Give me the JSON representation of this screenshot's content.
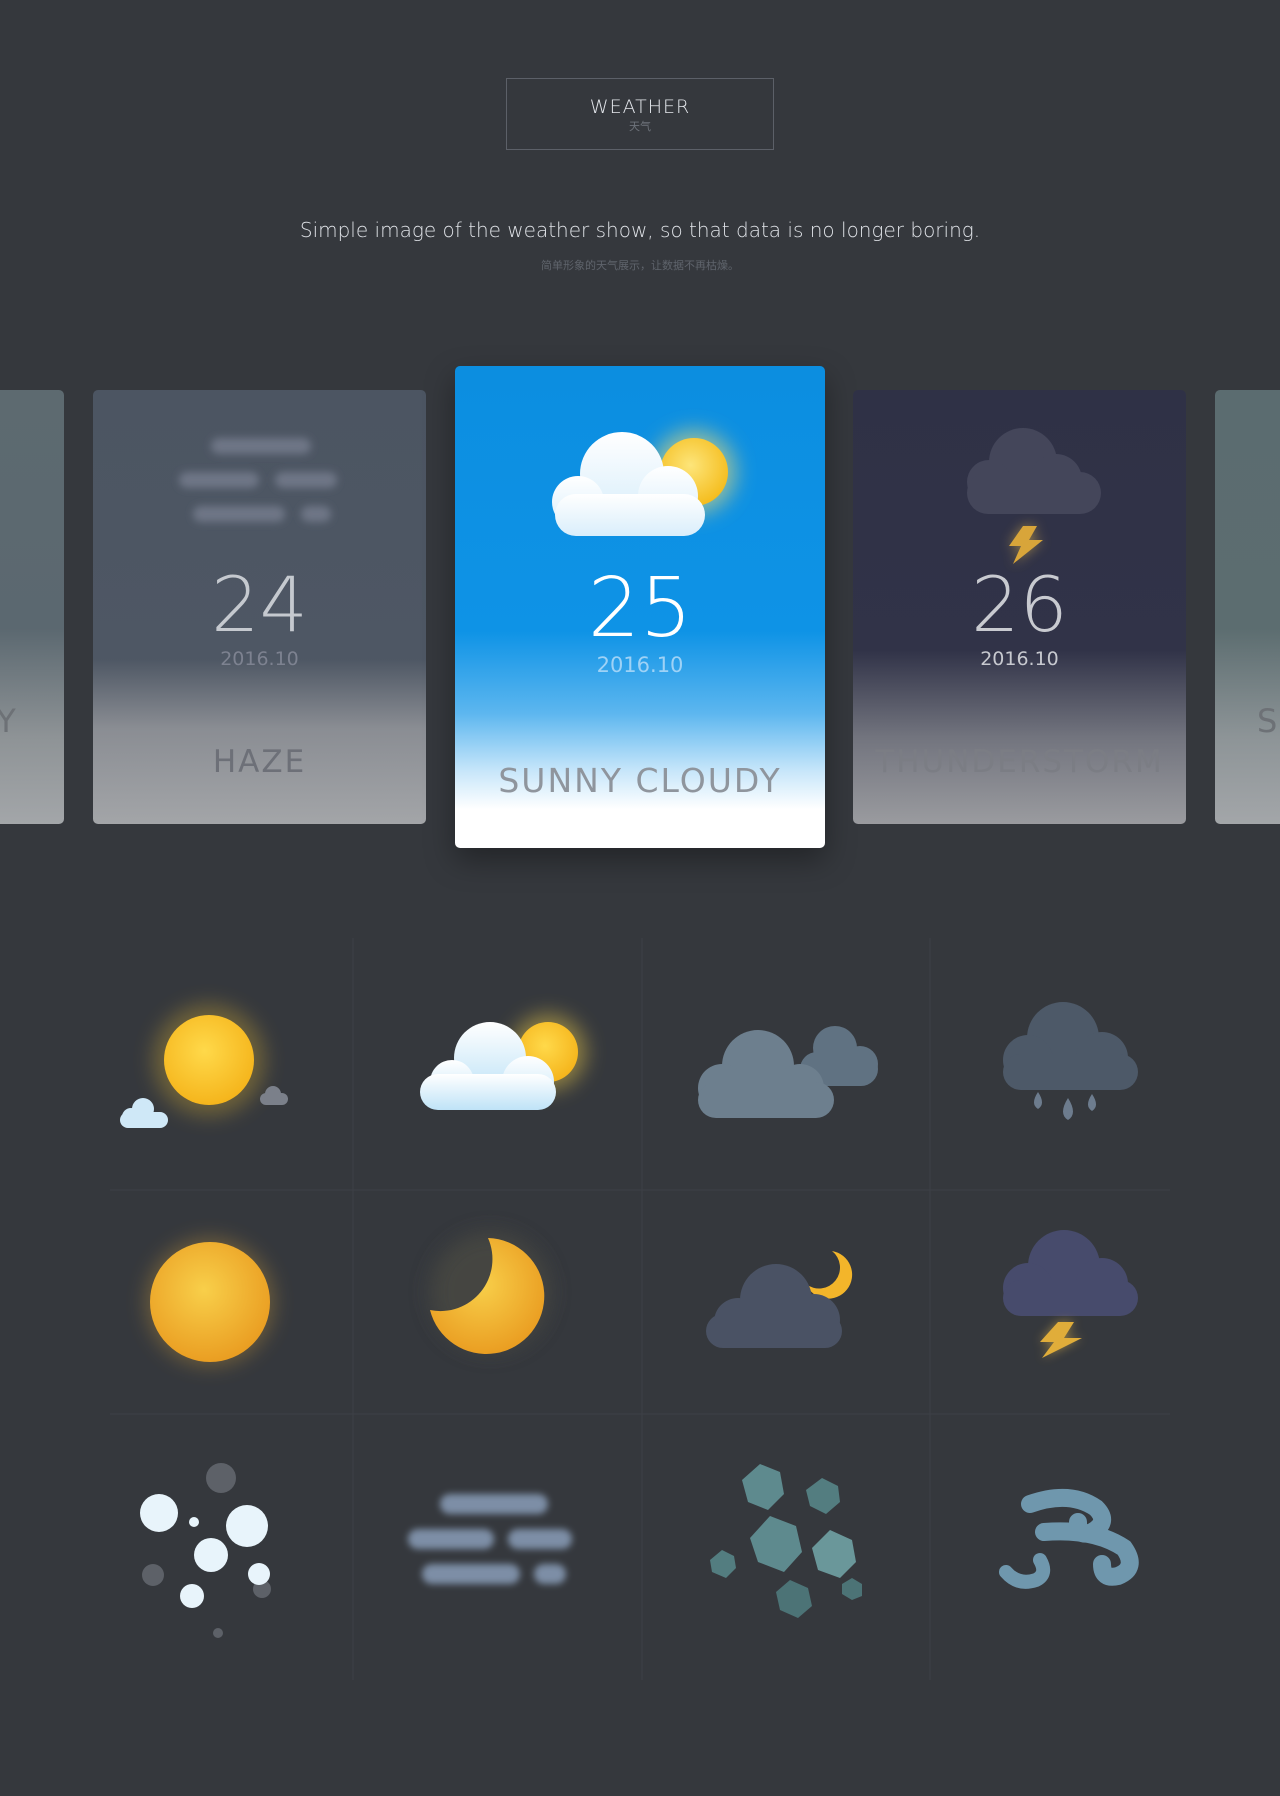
{
  "header": {
    "title": "WEATHER",
    "subtitle": "天气"
  },
  "tagline": {
    "main": "Simple image of the weather show, so that data is no longer boring.",
    "sub": "简单形象的天气展示，让数据不再枯燥。"
  },
  "cards": {
    "left_edge": {
      "condition": "Y"
    },
    "haze": {
      "temperature": "24",
      "date": "2016.10",
      "condition": "HAZE",
      "icon": "haze-icon"
    },
    "selected": {
      "temperature": "25",
      "date": "2016.10",
      "condition": "SUNNY CLOUDY",
      "icon": "sunny-cloudy-icon"
    },
    "storm": {
      "temperature": "26",
      "date": "2016.10",
      "condition": "THUNDERSTORM",
      "icon": "thunderstorm-icon"
    },
    "right_edge": {
      "condition": "S"
    }
  },
  "icon_grid": [
    [
      "sunny-icon",
      "sunny-cloudy-icon",
      "cloudy-icon",
      "rain-icon"
    ],
    [
      "sun-icon",
      "moon-icon",
      "cloudy-night-icon",
      "thunderstorm-icon"
    ],
    [
      "hail-icon",
      "haze-icon",
      "sleet-icon",
      "wind-icon"
    ]
  ],
  "colors": {
    "background": "#35383d",
    "sky_blue": "#0e93e6",
    "sun_yellow": "#f6c529",
    "storm_navy": "#2f3146"
  }
}
